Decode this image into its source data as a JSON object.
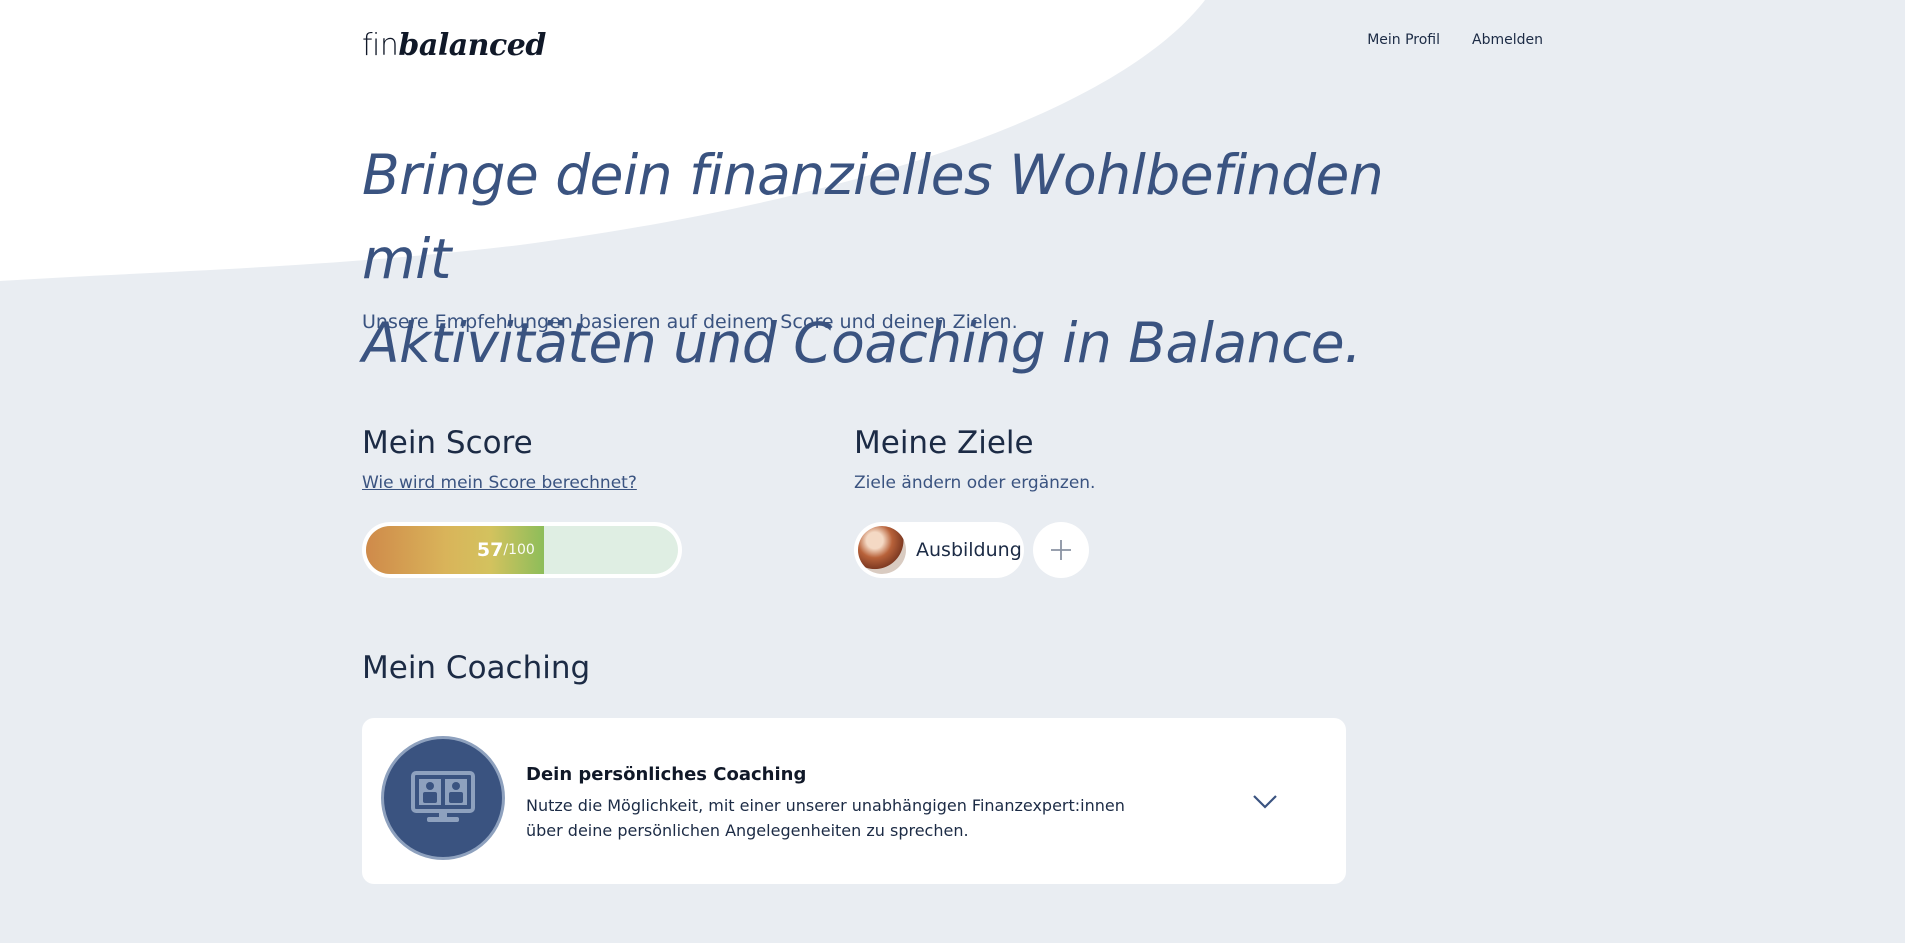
{
  "header": {
    "logo": {
      "part1": "fin",
      "part2": "balanced"
    },
    "nav": {
      "profile": "Mein Profil",
      "logout": "Abmelden"
    }
  },
  "hero": {
    "title_line1": "Bringe dein finanzielles Wohlbefinden mit",
    "title_line2": "Aktivitäten und Coaching in Balance.",
    "subtitle": "Unsere Empfehlungen basieren auf deinem Score und deinen Zielen."
  },
  "score": {
    "title": "Mein Score",
    "link": "Wie wird mein Score berechnet?",
    "value": 57,
    "value_text": "57",
    "max_text": "/100"
  },
  "goals": {
    "title": "Meine Ziele",
    "subtitle": "Ziele ändern oder ergänzen.",
    "items": [
      {
        "label": "Ausbildung",
        "icon": "education-photo"
      }
    ],
    "add_icon": "plus-icon"
  },
  "coaching": {
    "title": "Mein Coaching",
    "card": {
      "title": "Dein persönliches Coaching",
      "text": "Nutze die Möglichkeit, mit einer unserer unabhängigen Finanzexpert:innen über deine persönlichen Angelegenheiten zu sprechen.",
      "icon": "video-call-icon",
      "expand_icon": "chevron-down-icon"
    }
  },
  "colors": {
    "background": "#e9edf2",
    "primary": "#3a5380",
    "text": "#1c2b45",
    "card": "#ffffff"
  }
}
